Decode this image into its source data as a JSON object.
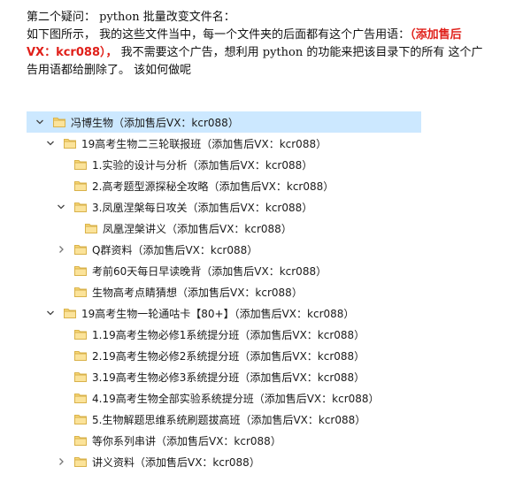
{
  "document": {
    "line1": "第二个疑问：  python 批量改变文件名：",
    "line2_a": "如下图所示，  我的这些文件当中，每一个文件夹的后面都有这个广告用语：",
    "line2_red": "（添加售后",
    "line3_red": "VX：kcr088），",
    "line3_b": "  我不需要这个广告，想利用 python 的功能来把该目录下的所有  这个广",
    "line4": "告用语都给删除了。  该如何做呢"
  },
  "tree": [
    {
      "label": "冯博生物（添加售后VX：kcr088）",
      "chevron": "down",
      "selected": true
    },
    {
      "label": "19高考生物二三轮联报班（添加售后VX：kcr088）",
      "chevron": "down"
    },
    {
      "label": "1.实验的设计与分析（添加售后VX：kcr088）",
      "chevron": ""
    },
    {
      "label": "2.高考题型源探秘全攻略（添加售后VX：kcr088）",
      "chevron": ""
    },
    {
      "label": "3.凤凰涅槃每日攻关（添加售后VX：kcr088）",
      "chevron": "down"
    },
    {
      "label": "凤凰涅槃讲义（添加售后VX：kcr088）",
      "chevron": ""
    },
    {
      "label": "Q群资料（添加售后VX：kcr088）",
      "chevron": "right"
    },
    {
      "label": "考前60天每日早读晚背（添加售后VX：kcr088）",
      "chevron": ""
    },
    {
      "label": "生物高考点睛猜想（添加售后VX：kcr088）",
      "chevron": ""
    },
    {
      "label": "19高考生物一轮通咕卡【80+】（添加售后VX：kcr088）",
      "chevron": "down"
    },
    {
      "label": "1.19高考生物必修1系统提分班（添加售后VX：kcr088）",
      "chevron": ""
    },
    {
      "label": "2.19高考生物必修2系统提分班（添加售后VX：kcr088）",
      "chevron": ""
    },
    {
      "label": "3.19高考生物必修3系统提分班（添加售后VX：kcr088）",
      "chevron": ""
    },
    {
      "label": "4.19高考生物全部实验系统提分班（添加售后VX：kcr088）",
      "chevron": ""
    },
    {
      "label": "5.生物解题思维系统刷题拔高班（添加售后VX：kcr088）",
      "chevron": ""
    },
    {
      "label": "等你系列串讲（添加售后VX：kcr088）",
      "chevron": ""
    },
    {
      "label": "讲义资料（添加售后VX：kcr088）",
      "chevron": "right"
    }
  ],
  "colors": {
    "selected_bg": "#cce8ff",
    "folder_yellow": "#f8d775",
    "red_text": "#e0201a"
  }
}
